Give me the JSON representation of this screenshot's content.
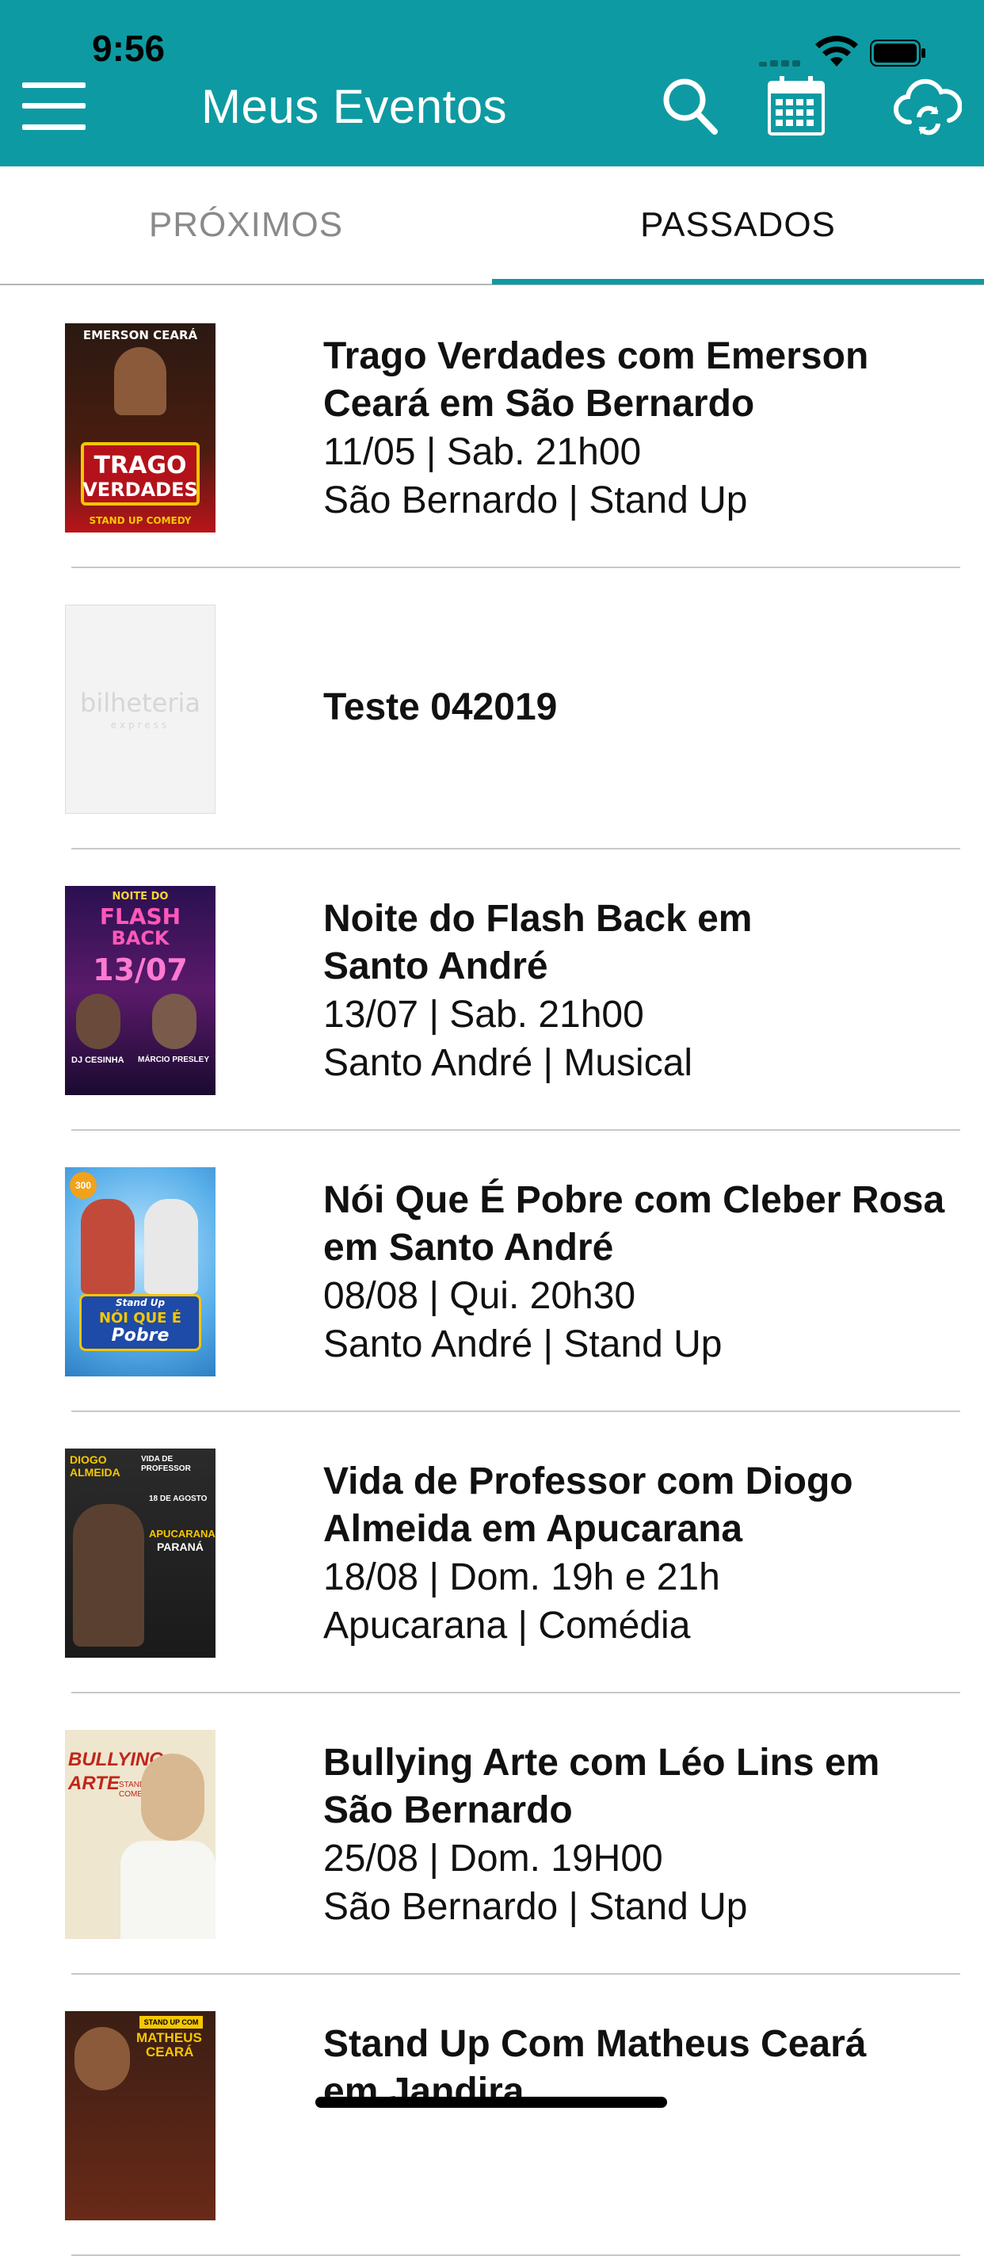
{
  "status_bar": {
    "time": "9:56"
  },
  "header": {
    "title": "Meus Eventos",
    "icons": [
      "menu-icon",
      "search-icon",
      "calendar-icon",
      "cloud-sync-icon"
    ],
    "bg_color": "#0e9aa2"
  },
  "tabs": [
    {
      "label": "PRÓXIMOS",
      "active": false
    },
    {
      "label": "PASSADOS",
      "active": true
    }
  ],
  "events": [
    {
      "title_line1": "Trago Verdades com Emerson",
      "title_line2": "Ceará em São Bernardo",
      "date": "11/05 | Sab. 21h00",
      "place": "São Bernardo | Stand Up",
      "poster": {
        "top": "EMERSON CEARÁ",
        "main1": "TRAGO",
        "main2": "VERDADES",
        "bottom": "STAND UP COMEDY"
      }
    },
    {
      "title_line1": "Teste 042019",
      "poster": {
        "main1": "bilheteria",
        "bottom": "express"
      }
    },
    {
      "title_line1": "Noite do Flash Back em",
      "title_line2": "Santo André",
      "date": "13/07 | Sab. 21h00",
      "place": "Santo André | Musical",
      "poster": {
        "top": "NOITE DO",
        "main1": "FLASH",
        "main2": "BACK",
        "date": "13/07",
        "left": "DJ CESINHA",
        "right": "MÁRCIO PRESLEY"
      }
    },
    {
      "title_line1": "Nói Que É Pobre com Cleber Rosa",
      "title_line2": "em Santo André",
      "date": "08/08 | Qui. 20h30",
      "place": "Santo André | Stand Up",
      "poster": {
        "badge": "300",
        "top": "Stand Up",
        "main1": "NÓI QUE É",
        "main2": "Pobre"
      }
    },
    {
      "title_line1": "Vida de Professor com Diogo",
      "title_line2": "Almeida em Apucarana",
      "date": "18/08 | Dom. 19h e 21h",
      "place": "Apucarana | Comédia",
      "poster": {
        "top1": "DIOGO",
        "top2": "ALMEIDA",
        "top3": "VIDA DE PROFESSOR",
        "date": "18 DE AGOSTO",
        "main1": "APUCARANA",
        "main2": "PARANÁ"
      }
    },
    {
      "title_line1": "Bullying Arte com Léo Lins em",
      "title_line2": "São Bernardo",
      "date": "25/08 | Dom. 19H00",
      "place": "São Bernardo | Stand Up",
      "poster": {
        "main1": "BULLYING",
        "main2": "ARTE",
        "sub": "STAND UP COMEDY"
      }
    },
    {
      "title_line1": "Stand Up Com Matheus Ceará",
      "title_line2": "em Jandira",
      "poster": {
        "top": "STAND UP COM",
        "main1": "MATHEUS",
        "main2": "CEARÁ"
      }
    }
  ]
}
